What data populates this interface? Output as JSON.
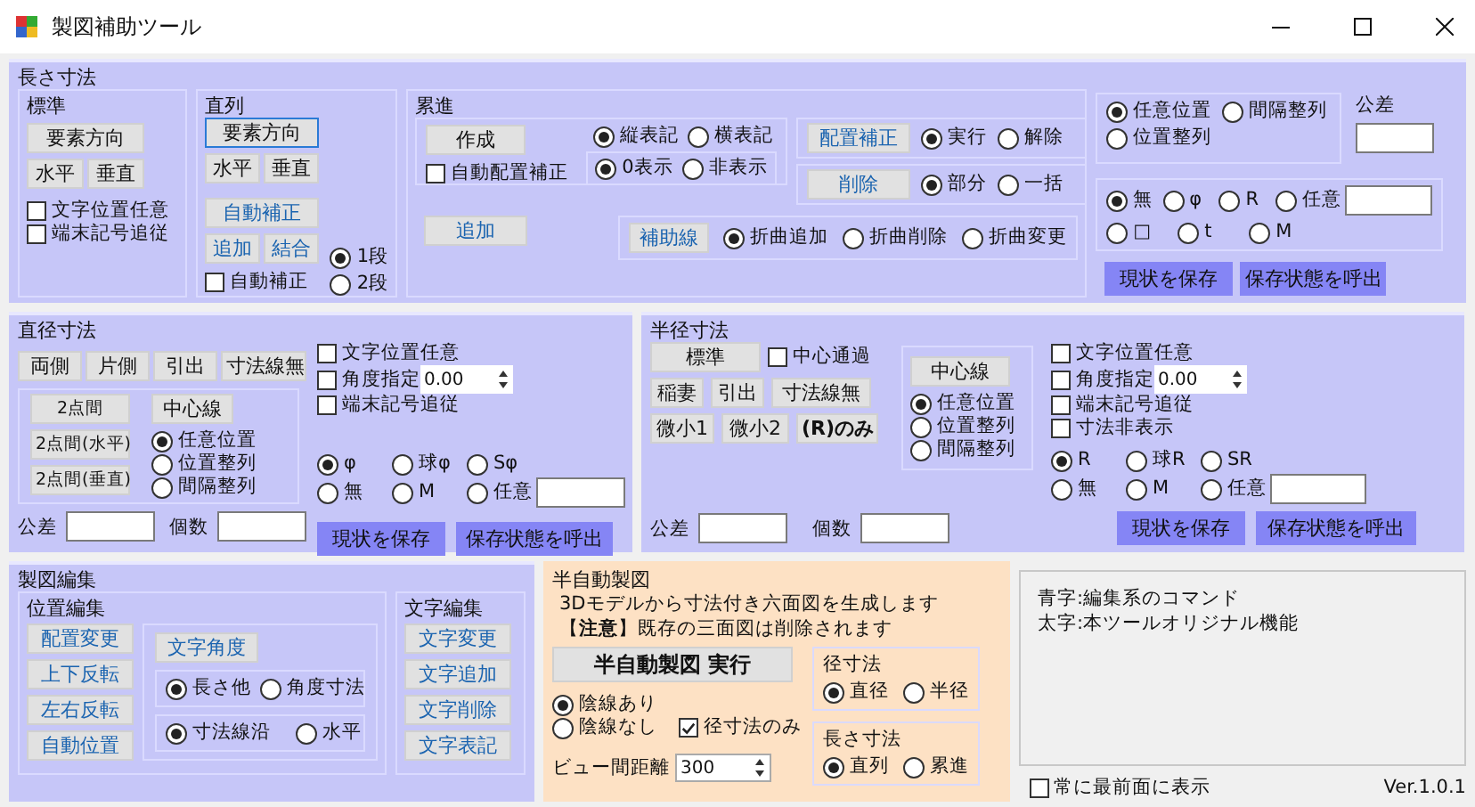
{
  "window": {
    "title": "製図補助ツール"
  },
  "length": {
    "title": "長さ寸法",
    "standard": {
      "title": "標準",
      "direction": {
        "label": "要素方向",
        "kind": "plain"
      },
      "horizontal": {
        "label": "水平",
        "kind": "plain"
      },
      "vertical": {
        "label": "垂直",
        "kind": "plain"
      },
      "checks": [
        {
          "label": "文字位置任意",
          "checked": false
        },
        {
          "label": "端末記号追従",
          "checked": false
        }
      ]
    },
    "series": {
      "title": "直列",
      "direction": {
        "label": "要素方向",
        "kind": "plain"
      },
      "horizontal": {
        "label": "水平",
        "kind": "plain"
      },
      "vertical": {
        "label": "垂直",
        "kind": "plain"
      },
      "auto_fix": {
        "label": "自動補正",
        "kind": "edit"
      },
      "add": {
        "label": "追加",
        "kind": "edit"
      },
      "join": {
        "label": "結合",
        "kind": "edit"
      },
      "auto_check": {
        "label": "自動補正",
        "checked": false
      },
      "levels": [
        {
          "label": "1段",
          "selected": true
        },
        {
          "label": "2段",
          "selected": false
        }
      ]
    },
    "cumulative": {
      "title": "累進",
      "create": {
        "label": "作成",
        "kind": "plain"
      },
      "auto_place": {
        "label": "自動配置補正",
        "checked": false
      },
      "orientation": [
        {
          "label": "縦表記",
          "selected": true
        },
        {
          "label": "横表記",
          "selected": false
        }
      ],
      "zero": [
        {
          "label": "0表示",
          "selected": true
        },
        {
          "label": "非表示",
          "selected": false
        }
      ],
      "place_fix": {
        "label": "配置補正",
        "kind": "edit"
      },
      "place_fix_opts": [
        {
          "label": "実行",
          "selected": true
        },
        {
          "label": "解除",
          "selected": false
        }
      ],
      "delete": {
        "label": "削除",
        "kind": "edit"
      },
      "delete_opts": [
        {
          "label": "部分",
          "selected": true
        },
        {
          "label": "一括",
          "selected": false
        }
      ],
      "add": {
        "label": "追加",
        "kind": "edit"
      },
      "aux": {
        "label": "補助線",
        "kind": "edit"
      },
      "aux_opts": [
        {
          "label": "折曲追加",
          "selected": true
        },
        {
          "label": "折曲削除",
          "selected": false
        },
        {
          "label": "折曲変更",
          "selected": false
        }
      ]
    },
    "position": [
      {
        "label": "任意位置",
        "selected": true
      },
      {
        "label": "間隔整列",
        "selected": false
      },
      {
        "label": "位置整列",
        "selected": false
      }
    ],
    "tolerance_label": "公差",
    "symbols": [
      {
        "label": "無",
        "selected": true
      },
      {
        "label": "φ",
        "selected": false
      },
      {
        "label": "R",
        "selected": false
      },
      {
        "label": "任意",
        "selected": false
      },
      {
        "label": "□",
        "selected": false
      },
      {
        "label": "t",
        "selected": false
      },
      {
        "label": "M",
        "selected": false
      }
    ],
    "save": {
      "label": "現状を保存",
      "kind": "save"
    },
    "load": {
      "label": "保存状態を呼出",
      "kind": "save"
    }
  },
  "diameter": {
    "title": "直径寸法",
    "styles": [
      {
        "label": "両側",
        "kind": "plain"
      },
      {
        "label": "片側",
        "kind": "plain"
      },
      {
        "label": "引出",
        "kind": "plain"
      },
      {
        "label": "寸法線無",
        "kind": "plain"
      }
    ],
    "two_point": [
      {
        "label": "2点間",
        "kind": "plain"
      },
      {
        "label": "2点間(水平)",
        "kind": "plain"
      },
      {
        "label": "2点間(垂直)",
        "kind": "plain"
      }
    ],
    "center_line": {
      "label": "中心線",
      "kind": "plain"
    },
    "position": [
      {
        "label": "任意位置",
        "selected": true
      },
      {
        "label": "位置整列",
        "selected": false
      },
      {
        "label": "間隔整列",
        "selected": false
      }
    ],
    "checks": [
      {
        "label": "文字位置任意",
        "checked": false
      },
      {
        "label": "角度指定",
        "checked": false
      },
      {
        "label": "端末記号追従",
        "checked": false
      }
    ],
    "angle_value": "0.00",
    "symbols": [
      {
        "label": "φ",
        "selected": true
      },
      {
        "label": "球φ",
        "selected": false
      },
      {
        "label": "Sφ",
        "selected": false
      },
      {
        "label": "無",
        "selected": false
      },
      {
        "label": "M",
        "selected": false
      },
      {
        "label": "任意",
        "selected": false
      }
    ],
    "tolerance_label": "公差",
    "count_label": "個数",
    "save": {
      "label": "現状を保存",
      "kind": "save"
    },
    "load": {
      "label": "保存状態を呼出",
      "kind": "save"
    }
  },
  "radius": {
    "title": "半径寸法",
    "standard": {
      "label": "標準",
      "kind": "plain"
    },
    "through_center": {
      "label": "中心通過",
      "checked": false
    },
    "styles": [
      {
        "label": "稲妻",
        "kind": "plain"
      },
      {
        "label": "引出",
        "kind": "plain"
      },
      {
        "label": "寸法線無",
        "kind": "plain"
      }
    ],
    "small": [
      {
        "label": "微小1",
        "kind": "plain"
      },
      {
        "label": "微小2",
        "kind": "plain"
      },
      {
        "label": "(R)のみ",
        "kind": "bold"
      }
    ],
    "center_line": {
      "label": "中心線",
      "kind": "plain"
    },
    "position": [
      {
        "label": "任意位置",
        "selected": true
      },
      {
        "label": "位置整列",
        "selected": false
      },
      {
        "label": "間隔整列",
        "selected": false
      }
    ],
    "checks": [
      {
        "label": "文字位置任意",
        "checked": false
      },
      {
        "label": "角度指定",
        "checked": false
      },
      {
        "label": "端末記号追従",
        "checked": false
      },
      {
        "label": "寸法非表示",
        "checked": false
      }
    ],
    "angle_value": "0.00",
    "symbols": [
      {
        "label": "R",
        "selected": true
      },
      {
        "label": "球R",
        "selected": false
      },
      {
        "label": "SR",
        "selected": false
      },
      {
        "label": "無",
        "selected": false
      },
      {
        "label": "M",
        "selected": false
      },
      {
        "label": "任意",
        "selected": false
      }
    ],
    "tolerance_label": "公差",
    "count_label": "個数",
    "save": {
      "label": "現状を保存",
      "kind": "save"
    },
    "load": {
      "label": "保存状態を呼出",
      "kind": "save"
    }
  },
  "edit": {
    "title": "製図編集",
    "position_title": "位置編集",
    "position_buttons": [
      {
        "label": "配置変更",
        "kind": "edit"
      },
      {
        "label": "上下反転",
        "kind": "edit"
      },
      {
        "label": "左右反転",
        "kind": "edit"
      },
      {
        "label": "自動位置",
        "kind": "edit"
      }
    ],
    "text_angle": {
      "label": "文字角度",
      "kind": "edit"
    },
    "angle_mode": [
      {
        "label": "長さ他",
        "selected": true
      },
      {
        "label": "角度寸法",
        "selected": false
      }
    ],
    "text_dir": [
      {
        "label": "寸法線沿",
        "selected": true
      },
      {
        "label": "水平",
        "selected": false
      }
    ],
    "text_title": "文字編集",
    "text_buttons": [
      {
        "label": "文字変更",
        "kind": "edit"
      },
      {
        "label": "文字追加",
        "kind": "edit"
      },
      {
        "label": "文字削除",
        "kind": "edit"
      },
      {
        "label": "文字表記",
        "kind": "edit"
      }
    ]
  },
  "auto": {
    "title": "半自動製図",
    "lines": [
      "3Dモデルから寸法付き六面図を生成します",
      "【**注意**】既存の三面図は削除されます"
    ],
    "run": {
      "label": "半自動製図 実行",
      "kind": "bold"
    },
    "hidden": [
      {
        "label": "陰線あり",
        "selected": true
      },
      {
        "label": "陰線なし",
        "selected": false
      }
    ],
    "dia_only": {
      "label": "径寸法のみ",
      "checked": true
    },
    "distance_label": "ビュー間距離",
    "distance": "300",
    "dia_title": "径寸法",
    "dia": [
      {
        "label": "直径",
        "selected": true
      },
      {
        "label": "半径",
        "selected": false
      }
    ],
    "len_title": "長さ寸法",
    "len": [
      {
        "label": "直列",
        "selected": true
      },
      {
        "label": "累進",
        "selected": false
      }
    ]
  },
  "legend": [
    "青字:編集系のコマンド",
    "太字:本ツールオリジナル機能"
  ],
  "topmost": {
    "label": "常に最前面に表示",
    "checked": false
  },
  "version": "Ver.1.0.1"
}
